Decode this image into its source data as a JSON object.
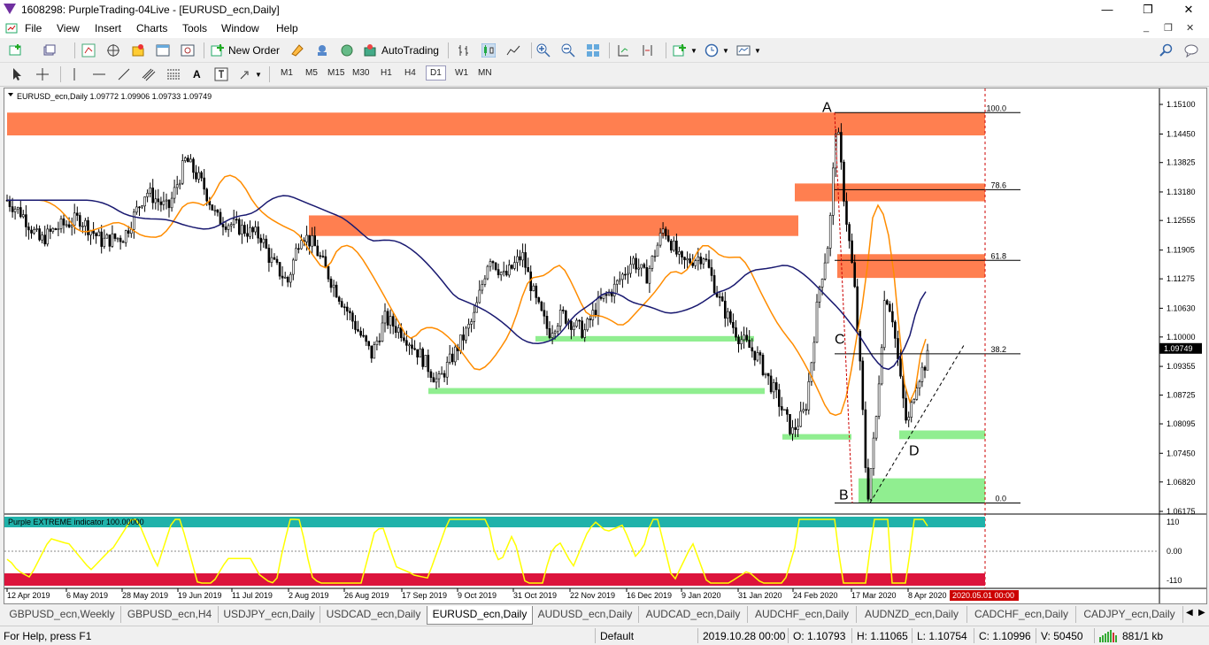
{
  "window": {
    "title": "1608298: PurpleTrading-04Live - [EURUSD_ecn,Daily]",
    "minimize": "—",
    "maximize": "❐",
    "close": "✕"
  },
  "menu": [
    "File",
    "View",
    "Insert",
    "Charts",
    "Tools",
    "Window",
    "Help"
  ],
  "mdi": {
    "minimize": "_",
    "restore": "❐",
    "close": "✕"
  },
  "toolbar": {
    "new_order": "New Order",
    "autotrading": "AutoTrading"
  },
  "timeframes": [
    "M1",
    "M5",
    "M15",
    "M30",
    "H1",
    "H4",
    "D1",
    "W1",
    "MN"
  ],
  "active_timeframe": "D1",
  "chart_header": "EURUSD_ecn,Daily  1.09772 1.09906 1.09733 1.09749",
  "indicator_label": "Purple EXTREME indicator 100.00000",
  "chart_data": {
    "type": "candlestick",
    "symbol": "EURUSD_ecn",
    "timeframe": "Daily",
    "ohlc_current": {
      "open": 1.09772,
      "high": 1.09906,
      "low": 1.09733,
      "close": 1.09749
    },
    "current_price": "1.09749",
    "price_ticks": [
      "1.15100",
      "1.14450",
      "1.13825",
      "1.13180",
      "1.12555",
      "1.11905",
      "1.11275",
      "1.10630",
      "1.10000",
      "1.09355",
      "1.08725",
      "1.08095",
      "1.07450",
      "1.06820",
      "1.06175"
    ],
    "date_ticks": [
      "12 Apr 2019",
      "6 May 2019",
      "28 May 2019",
      "19 Jun 2019",
      "11 Jul 2019",
      "2 Aug 2019",
      "26 Aug 2019",
      "17 Sep 2019",
      "9 Oct 2019",
      "31 Oct 2019",
      "22 Nov 2019",
      "16 Dec 2019",
      "9 Jan 2020",
      "31 Jan 2020",
      "24 Feb 2020",
      "17 Mar 2020",
      "8 Apr 2020"
    ],
    "future_date_label": "2020.05.01 00:00",
    "fibonacci_levels": [
      {
        "label": "100.0",
        "price": 1.1492
      },
      {
        "label": "78.6",
        "price": 1.1323
      },
      {
        "label": "61.8",
        "price": 1.1168
      },
      {
        "label": "38.2",
        "price": 1.0963
      },
      {
        "label": "0.0",
        "price": 1.0636
      }
    ],
    "pattern_points": [
      "A",
      "B",
      "C",
      "D"
    ],
    "resistance_zones": [
      {
        "from": "12 Apr 2019",
        "to": "2020.05.01",
        "low": 1.1442,
        "high": 1.1492
      },
      {
        "from": "2 Aug 2019",
        "to": "24 Feb 2020",
        "low": 1.1237,
        "high": 1.1253
      },
      {
        "from": "24 Feb 2020",
        "to": "2020.05.01",
        "low": 1.1313,
        "high": 1.1323
      },
      {
        "from": "17 Mar 2020",
        "to": "2020.05.01",
        "low": 1.1145,
        "high": 1.1168
      }
    ],
    "support_zones": [
      {
        "from": "17 Sep 2019",
        "to": "31 Jan 2020",
        "low": 1.0875,
        "high": 1.0888
      },
      {
        "from": "31 Oct 2019",
        "to": "31 Jan 2020",
        "low": 1.099,
        "high": 1.1002
      },
      {
        "from": "31 Jan 2020",
        "to": "17 Mar 2020",
        "low": 1.0775,
        "high": 1.0787
      },
      {
        "from": "8 Apr 2020",
        "to": "2020.05.01",
        "low": 1.0776,
        "high": 1.0795
      },
      {
        "from": "17 Mar 2020",
        "to": "2020.05.01",
        "low": 1.0637,
        "high": 1.069
      }
    ],
    "indicator": {
      "name": "Purple EXTREME indicator",
      "ticks": [
        "110",
        "0.00",
        "-110"
      ]
    }
  },
  "tabs": [
    "GBPUSD_ecn,Weekly",
    "GBPUSD_ecn,H4",
    "USDJPY_ecn,Daily",
    "USDCAD_ecn,Daily",
    "EURUSD_ecn,Daily",
    "AUDUSD_ecn,Daily",
    "AUDCAD_ecn,Daily",
    "AUDCHF_ecn,Daily",
    "AUDNZD_ecn,Daily",
    "CADCHF_ecn,Daily",
    "CADJPY_ecn,Daily"
  ],
  "active_tab": "EURUSD_ecn,Daily",
  "status": {
    "help": "For Help, press F1",
    "profile": "Default",
    "datetime": "2019.10.28 00:00",
    "open": "O: 1.10793",
    "high": "H: 1.11065",
    "low": "L: 1.10754",
    "close": "C: 1.10996",
    "volume": "V: 50450",
    "traffic": "881/1 kb"
  },
  "colors": {
    "resistance": "#ff7f50",
    "support": "#90ee90",
    "ma_fast": "#ff8c00",
    "ma_slow": "#191970",
    "indicator_line": "#ffff00",
    "indicator_top": "#20b2aa",
    "indicator_bottom": "#dc143c",
    "period_separator": "#cc0000"
  }
}
